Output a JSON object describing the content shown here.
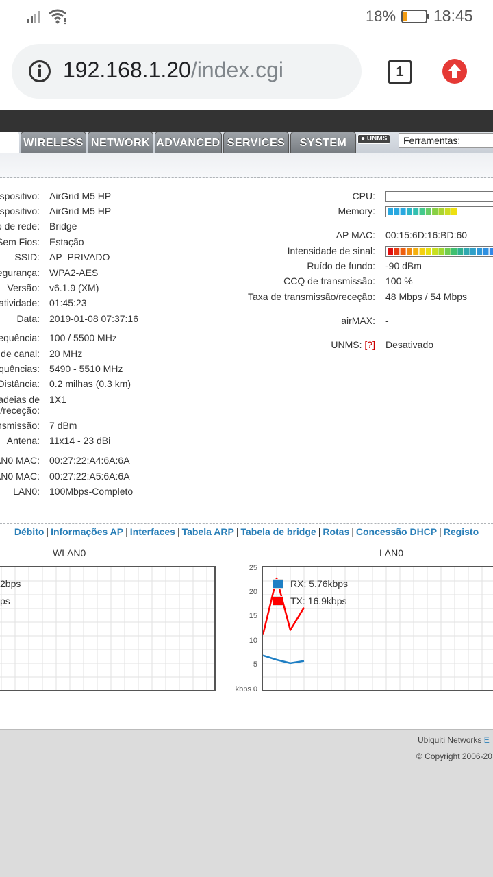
{
  "status_bar": {
    "battery": "18%",
    "clock": "18:45",
    "signal_icon": "cell-signal-icon",
    "wifi_icon": "wifi-icon",
    "battery_level": 0.18
  },
  "browser": {
    "url_host": "192.168.1.20",
    "url_path": "/index.cgi",
    "tab_count": "1"
  },
  "nav": {
    "tabs": [
      "WIRELESS",
      "NETWORK",
      "ADVANCED",
      "SERVICES",
      "SYSTEM"
    ],
    "unms": "UNMS",
    "tools": "Ferramentas:"
  },
  "left_rows": [
    {
      "label": "spositivo:",
      "value": "AirGrid M5 HP"
    },
    {
      "label": "spositivo:",
      "value": "AirGrid M5 HP"
    },
    {
      "label": "o de rede:",
      "value": "Bridge"
    },
    {
      "label": "Sem Fios:",
      "value": "Estação"
    },
    {
      "label": "SSID:",
      "value": "AP_PRIVADO"
    },
    {
      "label": "egurança:",
      "value": "WPA2-AES"
    },
    {
      "label": "Versão:",
      "value": "v6.1.9 (XM)"
    },
    {
      "label": "atividade:",
      "value": "01:45:23"
    },
    {
      "label": "Data:",
      "value": "2019-01-08 07:37:16"
    },
    {
      "label": "equência:",
      "value": "100 / 5500 MHz"
    },
    {
      "label": "de canal:",
      "value": "20 MHz"
    },
    {
      "label": "quências:",
      "value": "5490 - 5510 MHz"
    },
    {
      "label": "Distância:",
      "value": "0.2 milhas (0.3 km)"
    },
    {
      "label": "adeias de",
      "label2": "/receção:",
      "value": "1X1"
    },
    {
      "label": "nsmissão:",
      "value": "7 dBm"
    },
    {
      "label": "Antena:",
      "value": "11x14 - 23 dBi"
    },
    {
      "label": "AN0 MAC:",
      "value": "00:27:22:A4:6A:6A"
    },
    {
      "label": "AN0 MAC:",
      "value": "00:27:22:A5:6A:6A"
    },
    {
      "label": "LAN0:",
      "value": "100Mbps-Completo"
    }
  ],
  "right_rows": {
    "cpu_label": "CPU:",
    "memory_label": "Memory:",
    "ap_mac_label": "AP MAC:",
    "ap_mac": "00:15:6D:16:BD:60",
    "signal_label": "Intensidade de sinal:",
    "noise_label": "Ruído de fundo:",
    "noise": "-90 dBm",
    "ccq_label": "CCQ de transmissão:",
    "ccq": "100 %",
    "rate_label": "Taxa de transmissão/receção:",
    "rate": "48 Mbps / 54 Mbps",
    "airmax_label": "airMAX:",
    "airmax": "-",
    "unms_label": "UNMS:",
    "unms_help": "[?]",
    "unms": "Desativado"
  },
  "links": [
    {
      "label": "Débito",
      "active": true
    },
    {
      "label": "Informações AP"
    },
    {
      "label": "Interfaces"
    },
    {
      "label": "Tabela ARP"
    },
    {
      "label": "Tabela de bridge"
    },
    {
      "label": "Rotas"
    },
    {
      "label": "Concessão DHCP"
    },
    {
      "label": "Registo"
    }
  ],
  "graphs": {
    "wlan_title": "WLAN0",
    "wlan_rx_partial": "2bps",
    "wlan_tx_partial": "ps",
    "lan_title": "LAN0",
    "lan_rx": "RX: 5.76kbps",
    "lan_tx": "TX: 16.9kbps",
    "rx_color": "#1f7fc4",
    "tx_color": "#ff0000",
    "y_ticks": [
      "25",
      "20",
      "15",
      "10",
      "5",
      "kbps 0"
    ]
  },
  "chart_data": {
    "type": "line",
    "title": "LAN0",
    "ylabel": "kbps",
    "ylim": [
      0,
      25
    ],
    "x": [
      0,
      1,
      2,
      3
    ],
    "series": [
      {
        "name": "RX: 5.76kbps",
        "values": [
          6.9,
          6.0,
          5.3,
          5.76
        ]
      },
      {
        "name": "TX: 16.9kbps",
        "values": [
          11.2,
          23.0,
          12.2,
          16.9
        ]
      }
    ]
  },
  "footer": {
    "brand": "Ubiquiti Networks",
    "brand_ext": "E",
    "copyright": "© Copyright 2006-20"
  }
}
